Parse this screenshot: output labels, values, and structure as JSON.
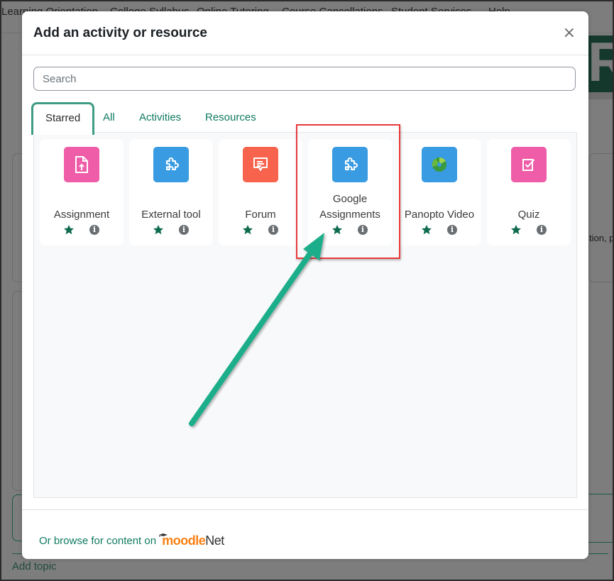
{
  "background": {
    "nav_items": [
      "Learning Orientation",
      "College Syllabus",
      "Online Tutoring",
      "Course Cancellations",
      "Student Services",
      "Help"
    ],
    "banner_text": "RS",
    "side_text": "tion, p",
    "add_topic": "Add topic"
  },
  "modal": {
    "title": "Add an activity or resource",
    "close_glyph": "×",
    "search_placeholder": "Search",
    "tabs": [
      {
        "label": "Starred",
        "active": true
      },
      {
        "label": "All",
        "active": false
      },
      {
        "label": "Activities",
        "active": false
      },
      {
        "label": "Resources",
        "active": false
      }
    ],
    "items": [
      {
        "name": "Assignment",
        "icon": "assignment-upload-icon",
        "color": "#ef5da8",
        "starred": true
      },
      {
        "name": "External tool",
        "icon": "puzzle-piece-icon",
        "color": "#399be2",
        "starred": true
      },
      {
        "name": "Forum",
        "icon": "forum-speech-bubble-icon",
        "color": "#f7634d",
        "starred": true
      },
      {
        "name": "Google Assignments",
        "icon": "puzzle-piece-icon",
        "color": "#399be2",
        "starred": true,
        "highlighted": true
      },
      {
        "name": "Panopto Video",
        "icon": "panopto-logo-icon",
        "color": "#399be2",
        "starred": true
      },
      {
        "name": "Quiz",
        "icon": "quiz-checkbox-icon",
        "color": "#ef5da8",
        "starred": true
      }
    ],
    "info_glyph": "i",
    "footer": {
      "browse_text": "Or browse for content on",
      "brand_main": "moodle",
      "brand_suffix": "Net"
    }
  },
  "annotation": {
    "highlight_color": "#e8393c",
    "arrow_color": "#1aae8a",
    "target": "Google Assignments"
  },
  "colors": {
    "accent": "#0f7a60",
    "tab_active_border": "#3f9b84",
    "star": "#0f6b4f"
  }
}
